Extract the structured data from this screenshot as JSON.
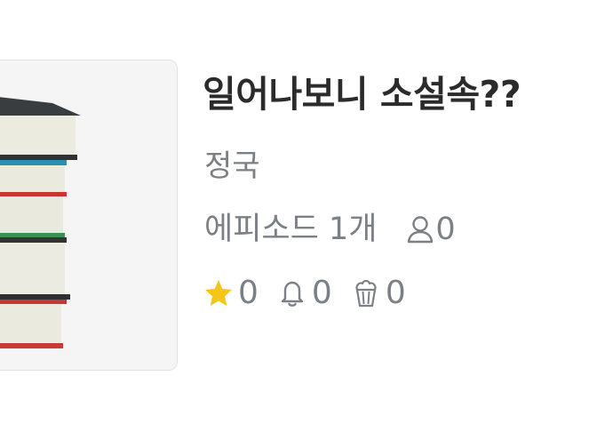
{
  "novel": {
    "title": "일어나보니 소설속??",
    "author": "정국",
    "episodes": "에피소드 1개",
    "readers": "0",
    "stars": "0",
    "subscribers": "0",
    "popcorn": "0"
  },
  "icons": {
    "readers": "person-icon",
    "stars": "star-icon",
    "subscribers": "bell-icon",
    "popcorn": "popcorn-icon"
  },
  "colors": {
    "title": "#2b2b2b",
    "muted": "#7b7f86",
    "star": "#f5c518"
  }
}
